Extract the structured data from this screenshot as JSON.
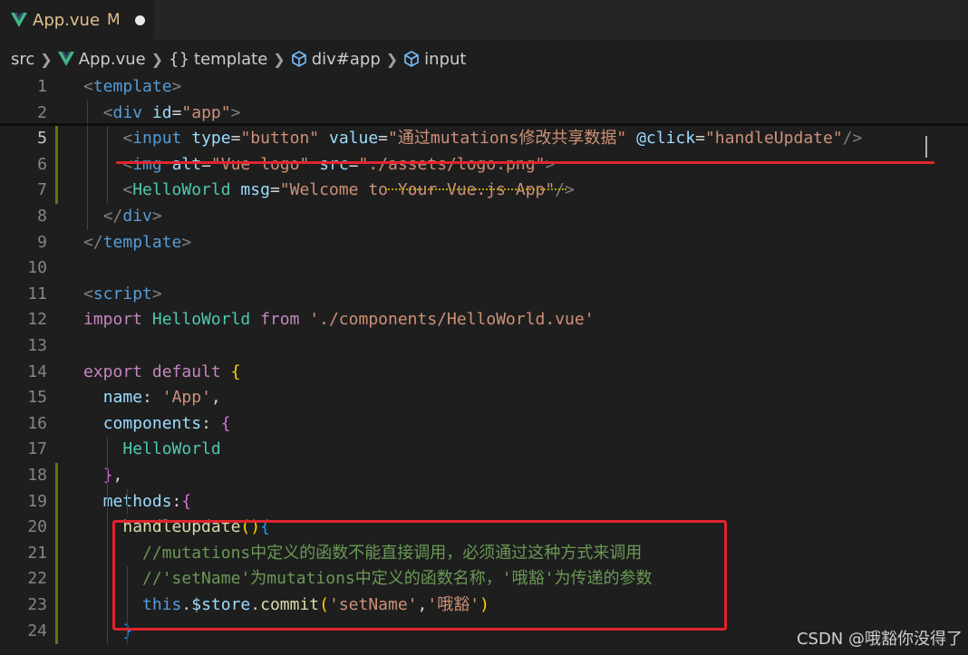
{
  "tab": {
    "title": "App.vue",
    "status": "M",
    "icon": "vue-icon"
  },
  "breadcrumb": {
    "items": [
      {
        "label": "src",
        "icon": ""
      },
      {
        "label": "App.vue",
        "icon": "vue-icon"
      },
      {
        "label": "template",
        "icon": "braces-icon"
      },
      {
        "label": "div#app",
        "icon": "cube-icon"
      },
      {
        "label": "input",
        "icon": "cube-icon"
      }
    ]
  },
  "colors": {
    "keyword": "#c586c0",
    "tag": "#569cd6",
    "attribute": "#9cdcfe",
    "string": "#ce9178",
    "comment": "#6a9955",
    "highlight": "#e0242e"
  },
  "editor": {
    "lines": [
      {
        "num": "1",
        "text": "<template>"
      },
      {
        "num": "2",
        "text": "  <div id=\"app\">"
      },
      {
        "num": "5",
        "text": "    <input type=\"button\" value=\"通过mutations修改共享数据\" @click=\"handleUpdate\"/>"
      },
      {
        "num": "6",
        "text": "    <img alt=\"Vue logo\" src=\"./assets/logo.png\">"
      },
      {
        "num": "7",
        "text": "    <HelloWorld msg=\"Welcome to Your Vue.js App\"/>"
      },
      {
        "num": "8",
        "text": "  </div>"
      },
      {
        "num": "9",
        "text": "</template>"
      },
      {
        "num": "10",
        "text": ""
      },
      {
        "num": "11",
        "text": "<script>"
      },
      {
        "num": "12",
        "text": "import HelloWorld from './components/HelloWorld.vue'"
      },
      {
        "num": "13",
        "text": ""
      },
      {
        "num": "14",
        "text": "export default {"
      },
      {
        "num": "15",
        "text": "  name: 'App',"
      },
      {
        "num": "16",
        "text": "  components: {"
      },
      {
        "num": "17",
        "text": "    HelloWorld"
      },
      {
        "num": "18",
        "text": "  },"
      },
      {
        "num": "19",
        "text": "  methods:{"
      },
      {
        "num": "20",
        "text": "    handleUpdate(){"
      },
      {
        "num": "21",
        "text": "      //mutations中定义的函数不能直接调用，必须通过这种方式来调用"
      },
      {
        "num": "22",
        "text": "      //'setName'为mutations中定义的函数名称，'哦豁'为传递的参数"
      },
      {
        "num": "23",
        "text": "      this.$store.commit('setName','哦豁')"
      },
      {
        "num": "24",
        "text": "    }"
      }
    ]
  },
  "watermark": "CSDN @哦豁你没得了"
}
